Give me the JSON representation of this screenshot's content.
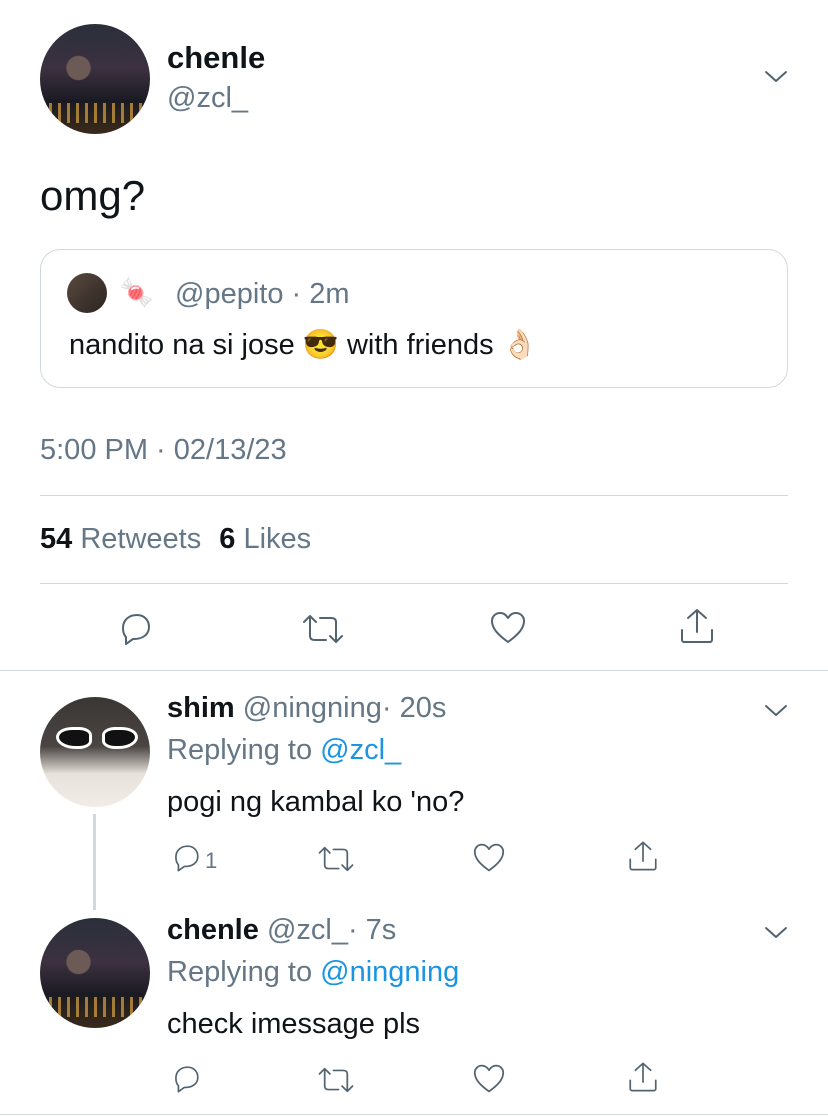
{
  "main_tweet": {
    "display_name": "chenle",
    "handle": "@zcl_",
    "text": "omg?",
    "timestamp": "5:00 PM · 02/13/23",
    "retweets_count": "54",
    "retweets_label": "Retweets",
    "likes_count": "6",
    "likes_label": "Likes"
  },
  "quoted_tweet": {
    "handle": "@pepito",
    "time": "· 2m",
    "text_before": "nandito na si jose",
    "emoji1": "😎",
    "text_middle": "with friends",
    "emoji2": "👌🏻",
    "name_emoji": "🍬"
  },
  "replies": [
    {
      "display_name": "shim",
      "handle": "@ningning",
      "time": "· 20s",
      "replying_label": "Replying to",
      "replying_to": "@zcl_",
      "text": "pogi ng kambal ko 'no?",
      "reply_count": "1"
    },
    {
      "display_name": "chenle",
      "handle": "@zcl_",
      "time": "· 7s",
      "replying_label": "Replying to",
      "replying_to": "@ningning",
      "text": "check imessage pls",
      "reply_count": ""
    }
  ],
  "icons": {
    "reply": "speech-bubble",
    "retweet": "arrows-loop",
    "like": "heart",
    "share": "upload-arrow",
    "menu": "chevron-down"
  },
  "colors": {
    "link_blue": "#1b95e0",
    "secondary_gray": "#657786",
    "divider": "#cfd9de"
  }
}
